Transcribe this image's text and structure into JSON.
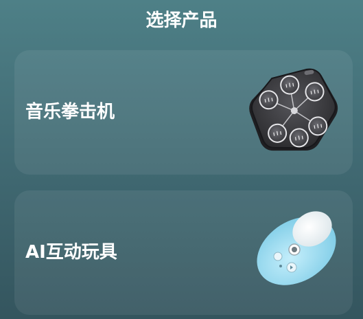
{
  "header": {
    "title": "选择产品"
  },
  "products": [
    {
      "label": "音乐拳击机",
      "image": "boxing-machine-image"
    },
    {
      "label": "AI互动玩具",
      "image": "interactive-toy-image"
    }
  ],
  "colors": {
    "background_top": "#4e8087",
    "background_bottom": "#34555e",
    "text": "#ffffff",
    "card": "rgba(255,255,255,0.07)",
    "boxing_body": "#3c3c3e",
    "toy_body": "#a6e0f4"
  }
}
